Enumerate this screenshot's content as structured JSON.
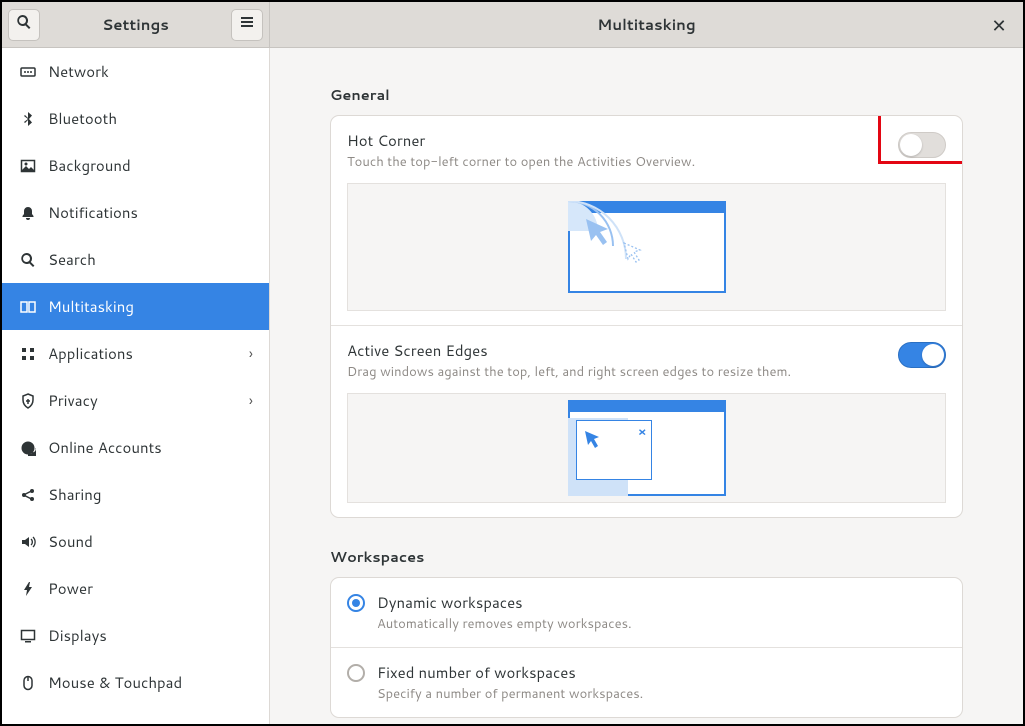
{
  "titlebar": {
    "settings_title": "Settings",
    "page_title": "Multitasking"
  },
  "sidebar": {
    "items": [
      {
        "label": "Network"
      },
      {
        "label": "Bluetooth"
      },
      {
        "label": "Background"
      },
      {
        "label": "Notifications"
      },
      {
        "label": "Search"
      },
      {
        "label": "Multitasking"
      },
      {
        "label": "Applications"
      },
      {
        "label": "Privacy"
      },
      {
        "label": "Online Accounts"
      },
      {
        "label": "Sharing"
      },
      {
        "label": "Sound"
      },
      {
        "label": "Power"
      },
      {
        "label": "Displays"
      },
      {
        "label": "Mouse & Touchpad"
      }
    ]
  },
  "general": {
    "heading": "General",
    "hot_corner": {
      "title": "Hot Corner",
      "subtitle": "Touch the top-left corner to open the Activities Overview.",
      "enabled": false
    },
    "active_edges": {
      "title": "Active Screen Edges",
      "subtitle": "Drag windows against the top, left, and right screen edges to resize them.",
      "enabled": true
    }
  },
  "workspaces": {
    "heading": "Workspaces",
    "dynamic": {
      "title": "Dynamic workspaces",
      "subtitle": "Automatically removes empty workspaces.",
      "selected": true
    },
    "fixed": {
      "title": "Fixed number of workspaces",
      "subtitle": "Specify a number of permanent workspaces.",
      "selected": false
    }
  },
  "colors": {
    "accent": "#3584e4",
    "highlight": "#e30613"
  }
}
